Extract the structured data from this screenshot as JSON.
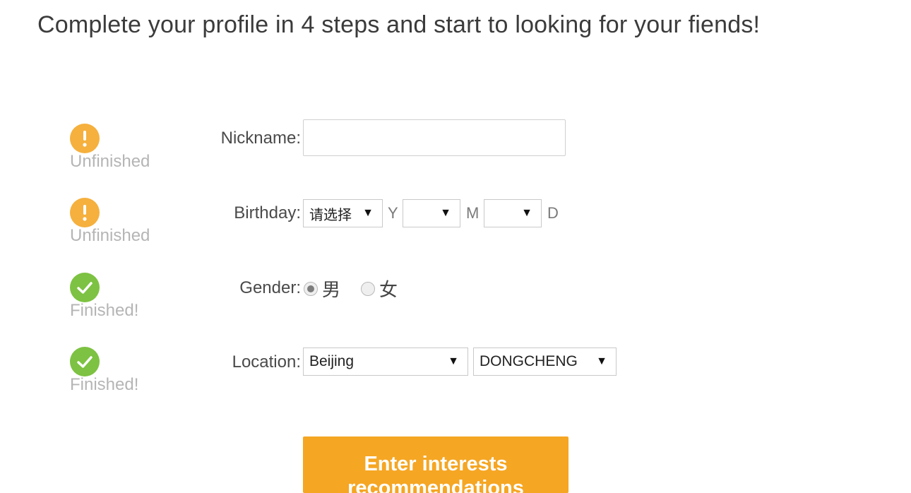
{
  "title": "Complete your profile in 4 steps and start to looking for your fiends!",
  "colors": {
    "unfinished": "#f5b03d",
    "finished": "#7dc242",
    "button": "#f5a623"
  },
  "steps": [
    {
      "status_label": "Unfinished",
      "icon": "exclamation-icon"
    },
    {
      "status_label": "Unfinished",
      "icon": "exclamation-icon"
    },
    {
      "status_label": "Finished!",
      "icon": "checkmark-icon"
    },
    {
      "status_label": "Finished!",
      "icon": "checkmark-icon"
    }
  ],
  "form": {
    "nickname": {
      "label": "Nickname:",
      "value": ""
    },
    "birthday": {
      "label": "Birthday:",
      "year_value": "请选择",
      "year_unit": "Y",
      "month_value": "",
      "month_unit": "M",
      "day_value": "",
      "day_unit": "D"
    },
    "gender": {
      "label": "Gender:",
      "options": [
        "男",
        "女"
      ],
      "selected": "男"
    },
    "location": {
      "label": "Location:",
      "city": "Beijing",
      "district": "DONGCHENG"
    }
  },
  "submit_label": "Enter interests recommendations"
}
